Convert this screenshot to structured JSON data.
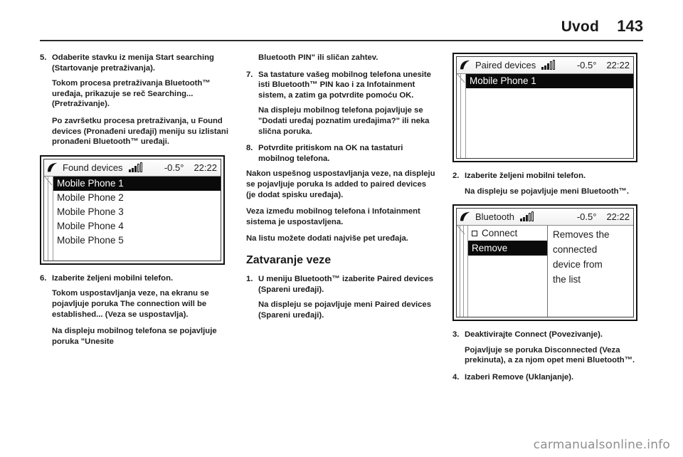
{
  "header": {
    "title": "Uvod",
    "page_number": "143"
  },
  "watermark": "carmanualsonline.info",
  "left_column": {
    "step5": {
      "num": "5.",
      "text": "Odaberite stavku iz menija Start searching (Startovanje pretraživanja)."
    },
    "p1": "Tokom procesa pretraživanja Bluetooth™ uređaja, prikazuje se reč Searching... (Pretraživanje).",
    "p2": "Po završetku procesa pretraživanja, u Found devices (Pronađeni uređaji) meniju su izlistani pronađeni Bluetooth™ uređaji.",
    "display": {
      "title": "Found devices",
      "temperature": "-0.5°",
      "clock": "22:22",
      "icons": [
        "phone-handset-icon",
        "signal-strength-icon"
      ],
      "items": [
        {
          "label": "Mobile Phone 1",
          "selected": true
        },
        {
          "label": "Mobile Phone 2",
          "selected": false
        },
        {
          "label": "Mobile Phone 3",
          "selected": false
        },
        {
          "label": "Mobile Phone 4",
          "selected": false
        },
        {
          "label": "Mobile Phone 5",
          "selected": false
        }
      ]
    },
    "step6": {
      "num": "6.",
      "text": "Izaberite željeni mobilni telefon."
    },
    "p3": "Tokom uspostavljanja veze, na ekranu se pojavljuje poruka The connection will be established... (Veza se uspostavlja).",
    "p4": "Na displeju mobilnog telefona se pojavljuje poruka \"Unesite"
  },
  "middle_column": {
    "p0": "Bluetooth PIN\" ili sličan zahtev.",
    "step7": {
      "num": "7.",
      "text": "Sa tastature vašeg mobilnog telefona unesite isti Bluetooth™ PIN kao i za Infotainment sistem, a zatim ga potvrdite pomoću OK."
    },
    "p1": "Na displeju mobilnog telefona pojavljuje se \"Dodati uređaj poznatim uređajima?\" ili neka slična poruka.",
    "step8": {
      "num": "8.",
      "text": "Potvrdite pritiskom na OK na tastaturi mobilnog telefona."
    },
    "p2": "Nakon uspešnog uspostavljanja veze, na displeju se pojavljuje poruka Is added to paired devices (je dodat spisku uređaja).",
    "p3": "Veza između mobilnog telefona i Infotainment sistema je uspostavljena.",
    "p4": "Na listu možete dodati najviše pet uređaja.",
    "section_title": "Zatvaranje veze",
    "step1": {
      "num": "1.",
      "text": "U meniju Bluetooth™ izaberite Paired devices (Spareni uređaji)."
    },
    "p5": "Na displeju se pojavljuje meni Paired devices (Spareni uređaji)."
  },
  "right_column": {
    "display_paired": {
      "title": "Paired devices",
      "temperature": "-0.5°",
      "clock": "22:22",
      "icons": [
        "phone-handset-icon",
        "signal-strength-icon"
      ],
      "items": [
        {
          "label": "Mobile Phone 1",
          "selected": true
        }
      ]
    },
    "step2": {
      "num": "2.",
      "text": "Izaberite željeni mobilni telefon."
    },
    "p1": "Na displeju se pojavljuje meni Bluetooth™.",
    "display_bluetooth": {
      "title": "Bluetooth",
      "temperature": "-0.5°",
      "clock": "22:22",
      "icons": [
        "phone-handset-icon",
        "signal-strength-icon"
      ],
      "menu": [
        {
          "label": "Connect",
          "checkbox": true,
          "selected": false
        },
        {
          "label": "Remove",
          "checkbox": false,
          "selected": true
        }
      ],
      "description_lines": [
        "Removes the",
        "connected",
        "device from",
        "the list"
      ]
    },
    "step3": {
      "num": "3.",
      "text": "Deaktivirajte Connect (Povezivanje)."
    },
    "p2": "Pojavljuje se poruka Disconnected (Veza prekinuta), a za njom opet meni Bluetooth™.",
    "step4": {
      "num": "4.",
      "text": "Izaberi Remove (Uklanjanje)."
    }
  }
}
